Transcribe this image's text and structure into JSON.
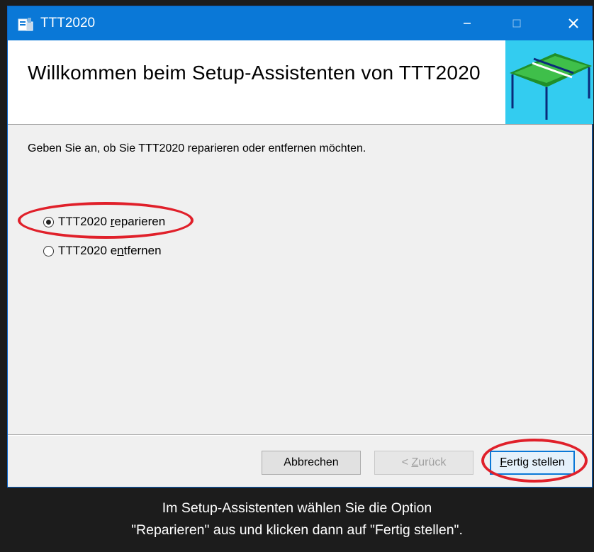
{
  "window": {
    "title": "TTT2020",
    "app_icon": "installer-icon",
    "controls": {
      "minimize": "–",
      "maximize": "☐",
      "close": "✕"
    }
  },
  "header": {
    "title": "Willkommen beim Setup-Assistenten von TTT2020",
    "graphic": "ping-pong-table-icon"
  },
  "body": {
    "prompt": "Geben Sie an, ob Sie TTT2020 reparieren oder entfernen möchten.",
    "options": [
      {
        "prefix": "TTT2020 ",
        "access_key": "r",
        "rest": "eparieren",
        "selected": true
      },
      {
        "prefix": "TTT2020 e",
        "access_key": "n",
        "rest": "tfernen",
        "selected": false
      }
    ]
  },
  "buttons": {
    "cancel": "Abbrechen",
    "back": {
      "prefix": "< ",
      "access_key": "Z",
      "rest": "urück"
    },
    "finish": {
      "prefix": "",
      "access_key": "F",
      "rest": "ertig stellen"
    }
  },
  "colors": {
    "titlebar": "#0a78d7",
    "highlight": "#e0202a",
    "header_graphic_bg": "#33ccf0"
  },
  "caption": {
    "line1": "Im Setup-Assistenten wählen Sie die Option",
    "line2": "\"Reparieren\" aus und klicken dann auf \"Fertig stellen\"."
  }
}
